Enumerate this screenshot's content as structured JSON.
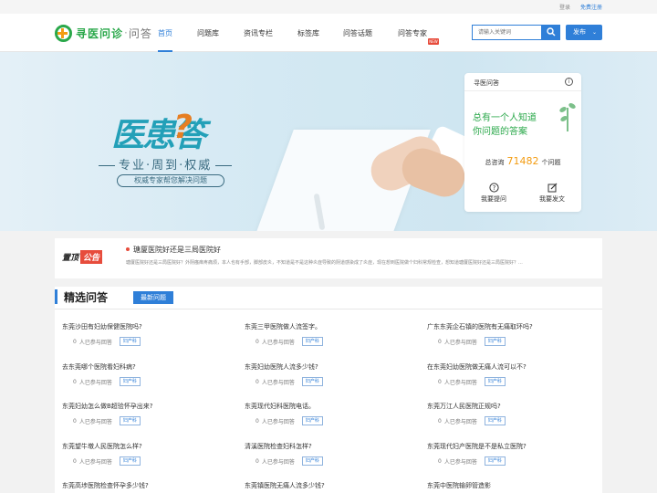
{
  "topbar": {
    "login": "登录",
    "register": "免费注册"
  },
  "logo": {
    "name": "寻医问诊",
    "dot": "·",
    "sub": "问答"
  },
  "nav": [
    "首页",
    "问题库",
    "资讯专栏",
    "标签库",
    "问答话题",
    "问答专家"
  ],
  "nav_badge": "NEW",
  "search": {
    "placeholder": "请输入关键词"
  },
  "publish": "发布",
  "banner": {
    "title_a": "医患",
    "title_q": "?",
    "title_b": "答",
    "slogan": "专业·周到·权威",
    "tag": "权威专家帮您解决问题"
  },
  "card": {
    "header": "寻医问答",
    "info": "i",
    "slogan1": "总有一个人知道",
    "slogan2": "你问题的答案",
    "stats_prefix": "总咨询",
    "stats_num": "71482",
    "stats_suffix": "个问题",
    "ask": "我要提问",
    "post": "我要发文"
  },
  "notice": {
    "label": "置顶",
    "label_red": "公告",
    "title": "瑭厦医院好还是三局医院好",
    "desc": "瑭厦医院好还是三局医院好？外阴瘙痒疼痛烦，本人也有手部，脚部皮炎，不知道是不是这种炎症导致的阴道感染成了炎症，现在想到医院做个妇科常规检查，想知道瑭厦医院好还是三局医院好？..."
  },
  "section": {
    "title": "精选问答",
    "tab": "最新问题"
  },
  "questions": [
    {
      "title": "东莞沙田有妇幼保健医院吗?",
      "count": "0",
      "suffix": "人已参与回答",
      "tag": "妇产科"
    },
    {
      "title": "东莞三甲医院做人流签字。",
      "count": "0",
      "suffix": "人已参与回答",
      "tag": "妇产科"
    },
    {
      "title": "广东东莞企石镇的医院有无痛取环吗?",
      "count": "0",
      "suffix": "人已参与回答",
      "tag": "妇产科"
    },
    {
      "title": "去东莞哪个医院看妇科病?",
      "count": "0",
      "suffix": "人已参与回答",
      "tag": "妇产科"
    },
    {
      "title": "东莞妇幼医院人流多少钱?",
      "count": "0",
      "suffix": "人已参与回答",
      "tag": "妇产科"
    },
    {
      "title": "在东莞妇幼医院做无痛人流可以不?",
      "count": "0",
      "suffix": "人已参与回答",
      "tag": "妇产科"
    },
    {
      "title": "东莞妇幼怎么做B超验怀孕出来?",
      "count": "0",
      "suffix": "人已参与回答",
      "tag": "妇产科"
    },
    {
      "title": "东莞现代妇科医院电话。",
      "count": "0",
      "suffix": "人已参与回答",
      "tag": "妇产科"
    },
    {
      "title": "东莞万江人民医院正规吗?",
      "count": "0",
      "suffix": "人已参与回答",
      "tag": "妇产科"
    },
    {
      "title": "东莞望牛墩人民医院怎么样?",
      "count": "0",
      "suffix": "人已参与回答",
      "tag": "妇产科"
    },
    {
      "title": "清溪医院检查妇科怎样?",
      "count": "0",
      "suffix": "人已参与回答",
      "tag": "妇产科"
    },
    {
      "title": "东莞现代妇产医院是不是私立医院?",
      "count": "0",
      "suffix": "人已参与回答",
      "tag": "妇产科"
    },
    {
      "title": "东莞高埗医院检查怀孕多少钱?",
      "count": "",
      "suffix": "",
      "tag": ""
    },
    {
      "title": "东莞镇医院无痛人流多少钱?",
      "count": "",
      "suffix": "",
      "tag": ""
    },
    {
      "title": "东莞中医院输卵管造影",
      "count": "",
      "suffix": "",
      "tag": ""
    }
  ],
  "colors": {
    "accent": "#2f7fd8",
    "brand_green": "#2aa84a",
    "orange": "#f39c12"
  }
}
